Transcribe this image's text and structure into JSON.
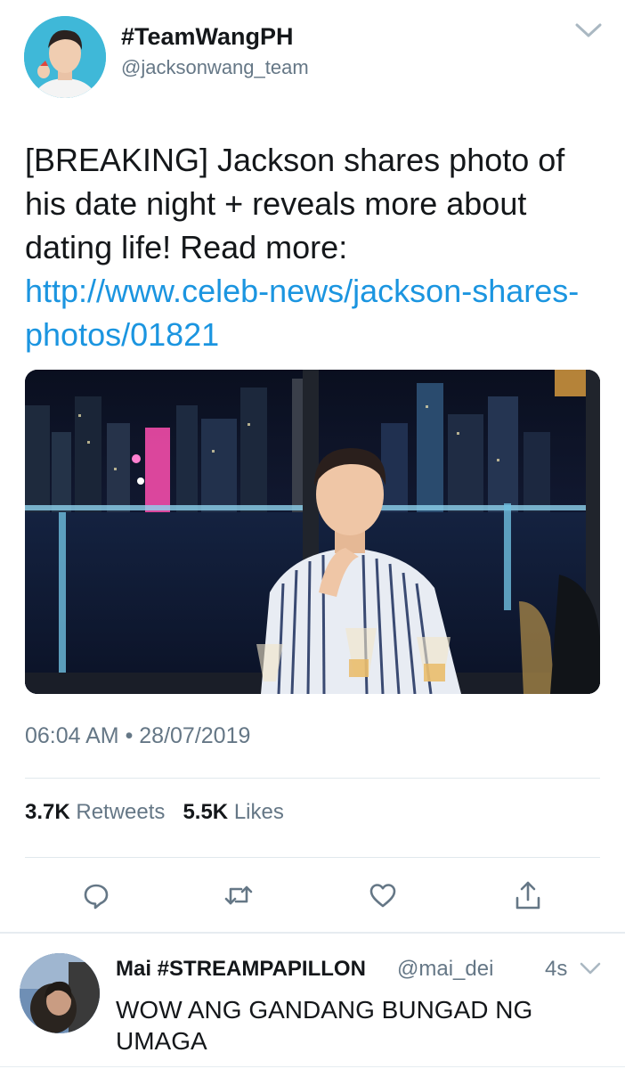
{
  "tweet": {
    "display_name": "#TeamWangPH",
    "handle": "@jacksonwang_team",
    "text_prefix": "[BREAKING] Jackson shares photo of his date night + reveals more about dating life! Read more: ",
    "link": "http://www.celeb-news/jackson-shares-photos/01821",
    "timestamp": "06:04 AM • 28/07/2019",
    "retweets_count": "3.7K",
    "retweets_label": "Retweets",
    "likes_count": "5.5K",
    "likes_label": "Likes",
    "link_color": "#1b95e0"
  },
  "actions": {
    "reply_icon": "reply-icon",
    "retweet_icon": "retweet-icon",
    "like_icon": "heart-icon",
    "share_icon": "share-icon"
  },
  "reply": {
    "display_name": "Mai #STREAMPAPILLON",
    "handle": "@mai_dei",
    "time": "4s",
    "text": "WOW ANG GANDANG BUNGAD NG UMAGA"
  }
}
